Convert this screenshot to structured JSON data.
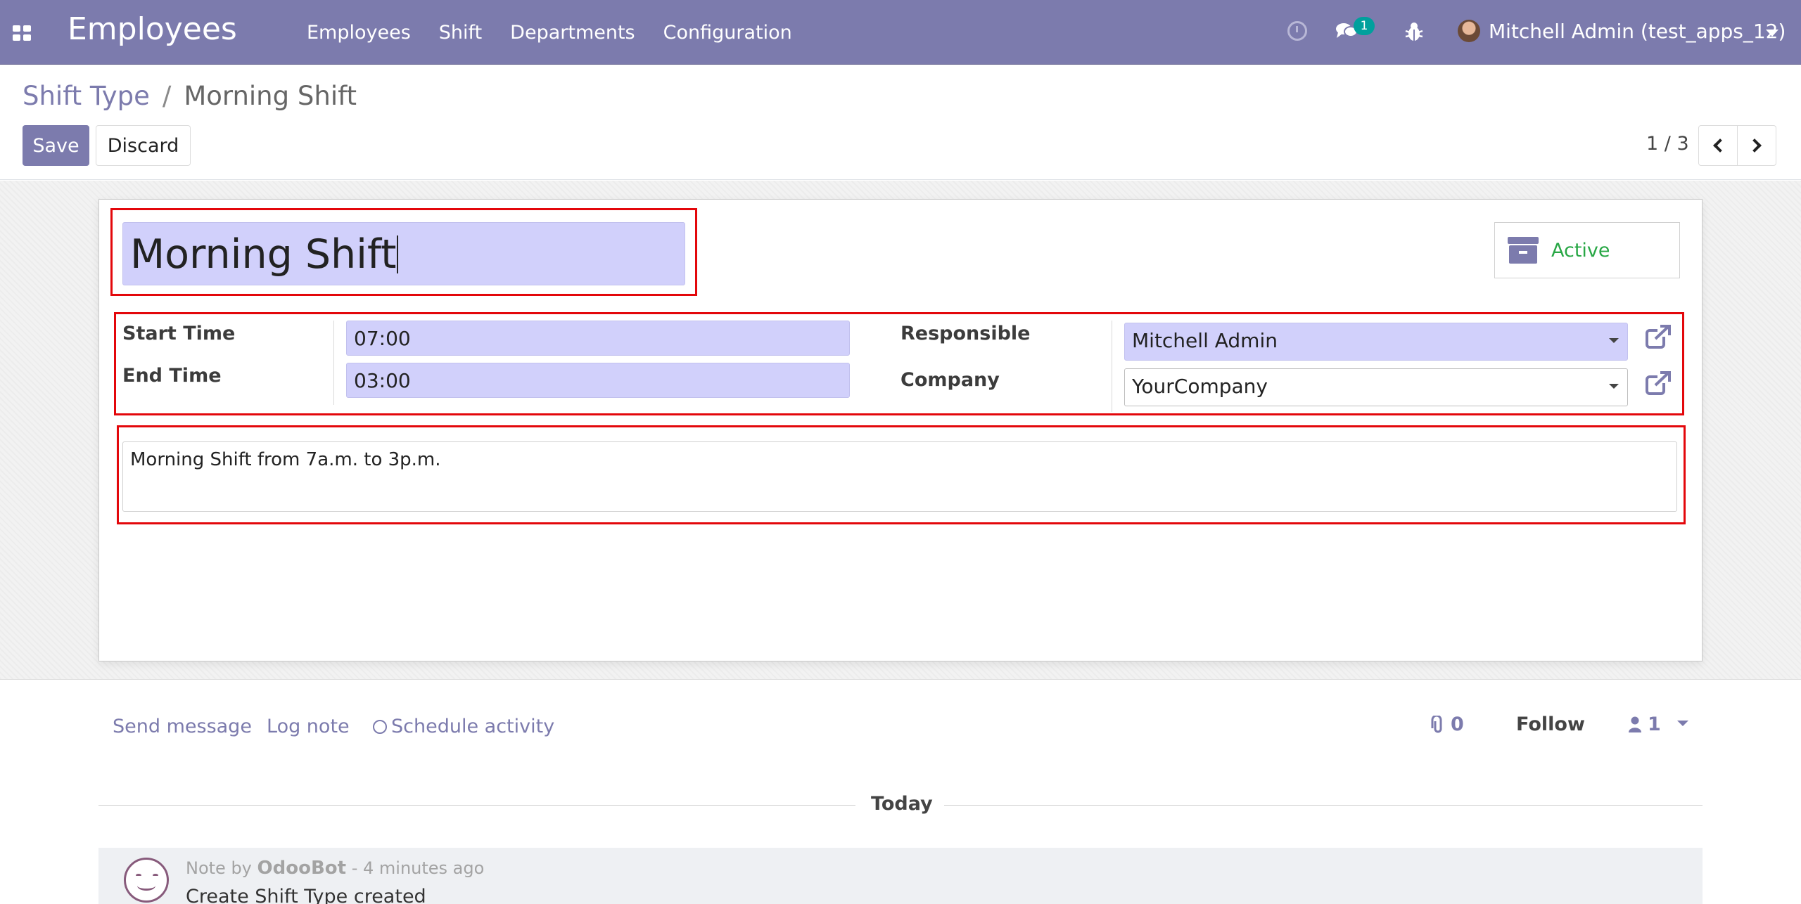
{
  "navbar": {
    "app_title": "Employees",
    "menu": [
      "Employees",
      "Shift",
      "Departments",
      "Configuration"
    ],
    "chat_badge": "1",
    "user": "Mitchell Admin (test_apps_12)"
  },
  "control_panel": {
    "breadcrumb": {
      "parent": "Shift Type",
      "separator": "/",
      "current": "Morning Shift"
    },
    "save_label": "Save",
    "discard_label": "Discard",
    "pager": "1 / 3"
  },
  "form": {
    "name": "Morning Shift",
    "active_label": "Active",
    "start_time_label": "Start Time",
    "start_time": "07:00",
    "end_time_label": "End Time",
    "end_time": "03:00",
    "responsible_label": "Responsible",
    "responsible": "Mitchell Admin",
    "company_label": "Company",
    "company": "YourCompany",
    "description": "Morning Shift from 7a.m. to 3p.m."
  },
  "chatter": {
    "send_message": "Send message",
    "log_note": "Log note",
    "schedule_activity": "Schedule activity",
    "attachments_count": "0",
    "follow_label": "Follow",
    "followers_count": "1",
    "date_separator": "Today",
    "message": {
      "prefix": "Note by",
      "author": "OdooBot",
      "time": "- 4 minutes ago",
      "body": "Create Shift Type created"
    }
  },
  "colors": {
    "brand": "#7c7bad",
    "required_field_bg": "#d1d0fb",
    "highlight_border": "#e3070b",
    "active_green": "#28a745"
  },
  "icons": [
    "apps-icon",
    "clock-icon",
    "chat-icon",
    "bug-icon",
    "archive-icon",
    "external-link-icon",
    "paperclip-icon",
    "user-icon",
    "chevron-left-icon",
    "chevron-right-icon"
  ]
}
